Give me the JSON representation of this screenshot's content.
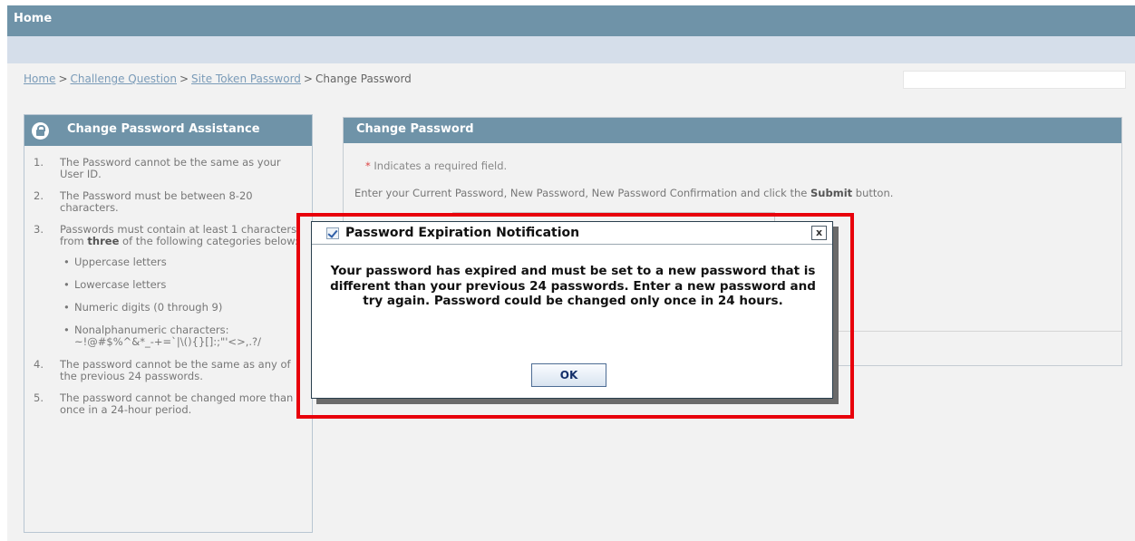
{
  "header": {
    "title": "Home"
  },
  "breadcrumb": {
    "items": [
      "Home",
      "Challenge Question",
      "Site Token Password"
    ],
    "current": "Change Password",
    "separator": ">"
  },
  "assistance": {
    "title": "Change Password Assistance",
    "rules": [
      {
        "num": "1.",
        "text": "The Password cannot be the same as your User ID."
      },
      {
        "num": "2.",
        "text": "The Password must be between 8-20 characters."
      },
      {
        "num": "3.",
        "text_before": "Passwords must contain at least 1 characters from ",
        "bold": "three",
        "text_after": " of the following categories below:"
      },
      {
        "num": "4.",
        "text": "The password cannot be the same as any of the previous 24 passwords."
      },
      {
        "num": "5.",
        "text": "The password cannot be changed more than once in a 24-hour period."
      }
    ],
    "categories": [
      "Uppercase letters",
      "Lowercase letters",
      "Numeric digits (0 through 9)",
      "Nonalphanumeric characters: ~!@#$%^&*_-+=`|\\(){}[]:;\"'<>,.?/"
    ]
  },
  "change_password": {
    "title": "Change Password",
    "required_star": "*",
    "required_note": "Indicates a required field.",
    "instruction_before": "Enter your Current Password, New Password, New Password Confirmation and click the ",
    "instruction_bold": "Submit",
    "instruction_after": " button."
  },
  "dialog": {
    "title": "Password Expiration Notification",
    "close_label": "x",
    "message": "Your password has expired and must be set to a new password that is different than your previous 24 passwords. Enter a new password and try again. Password could be changed only once in 24 hours.",
    "ok_label": "OK"
  },
  "colors": {
    "header_bg": "#6f93a8",
    "subbar_bg": "#d5deea",
    "highlight": "#e8000b",
    "link": "#7a9bb8"
  }
}
